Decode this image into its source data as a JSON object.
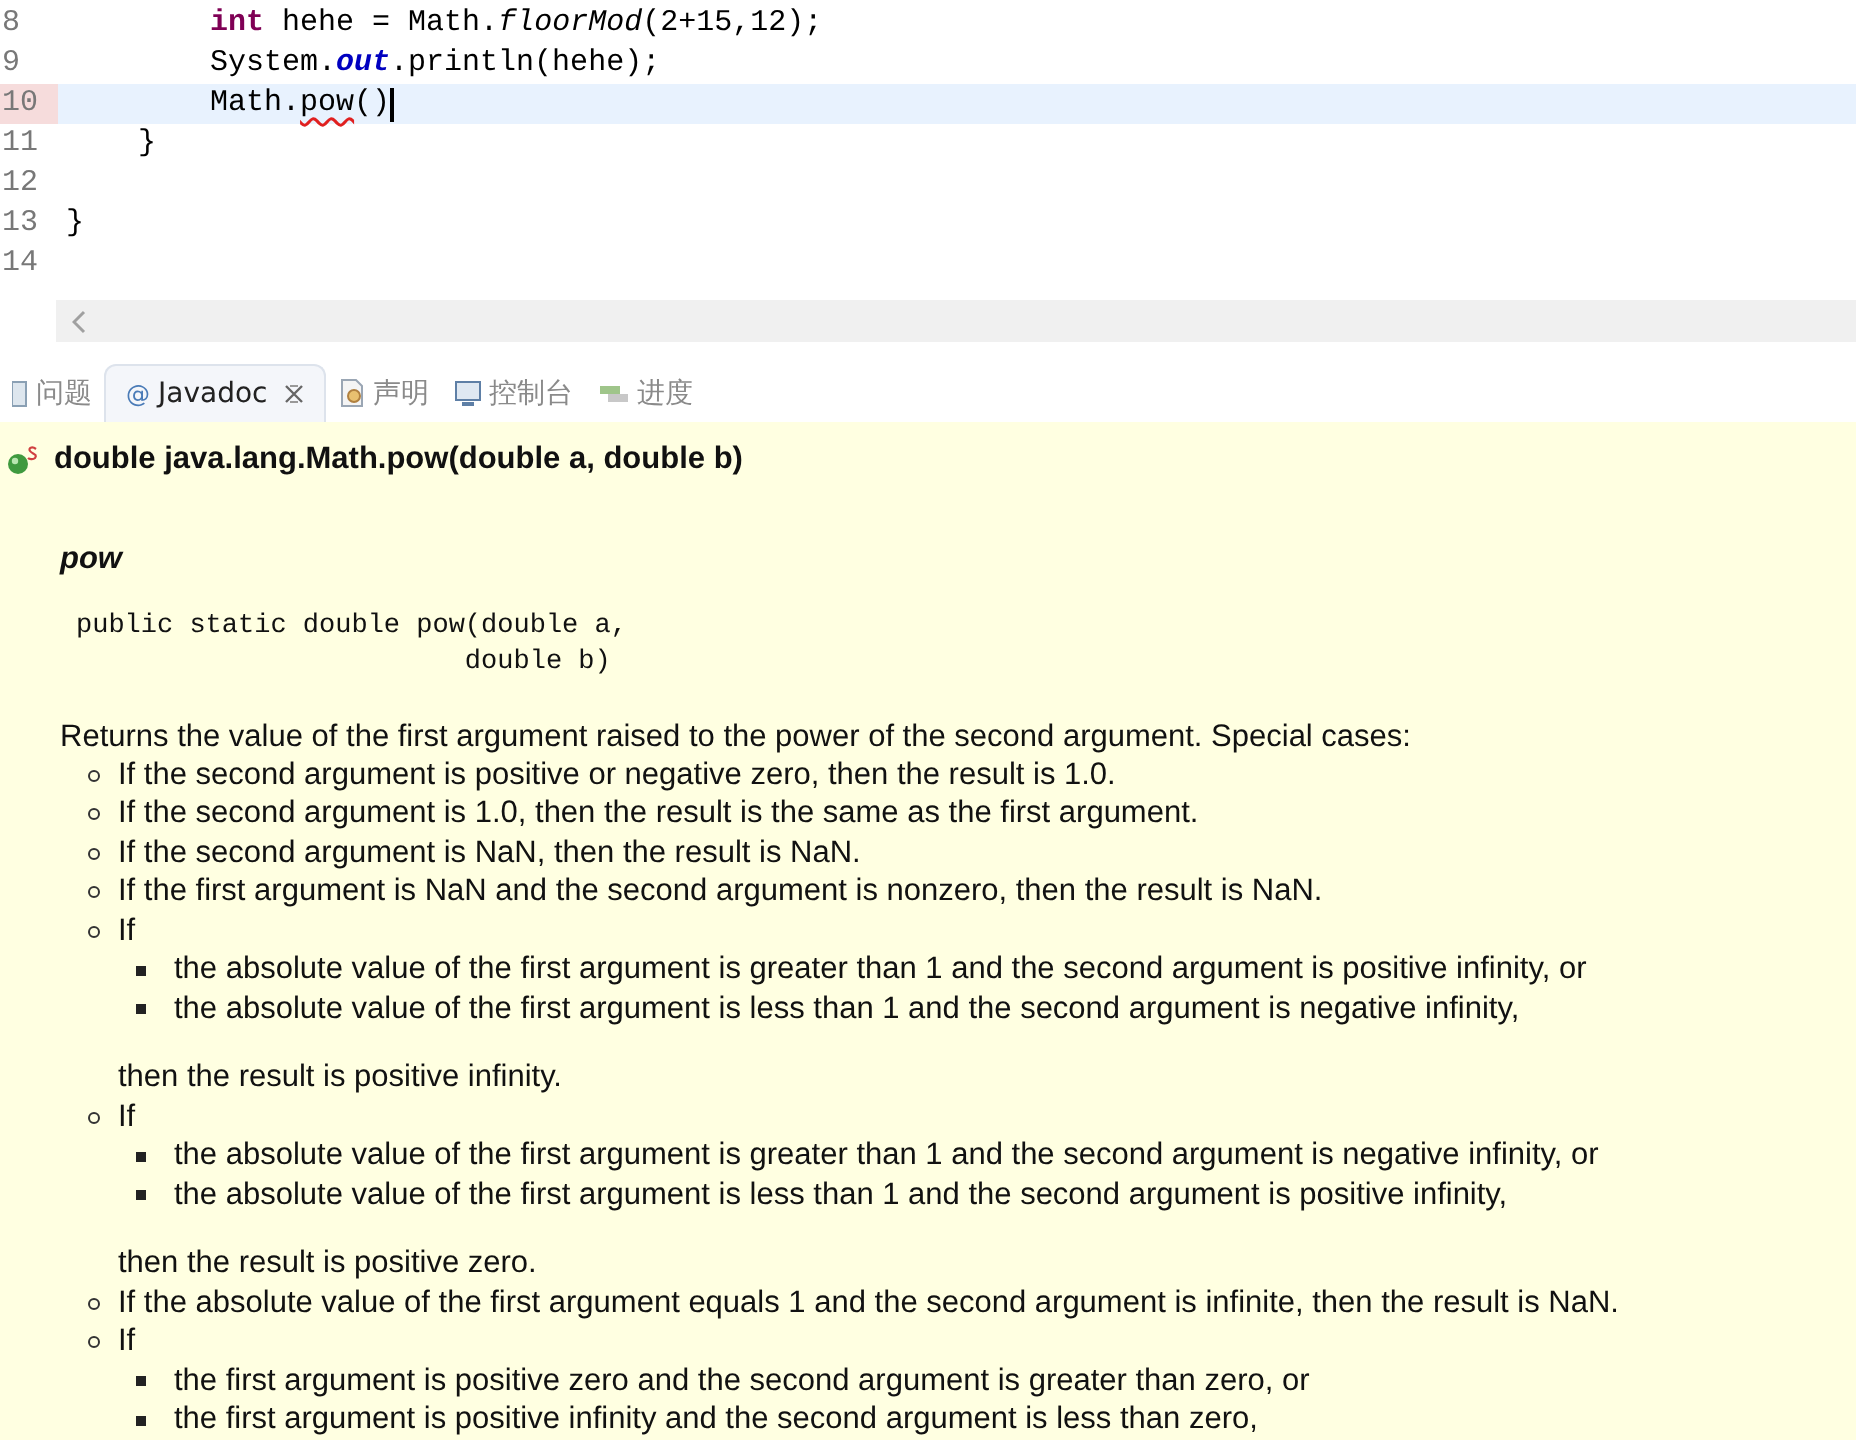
{
  "editor": {
    "lines": [
      {
        "number": "8",
        "current": false,
        "segments": [
          {
            "kind": "keyword",
            "text": "        int"
          },
          {
            "kind": "plain",
            "text": " hehe = Math."
          },
          {
            "kind": "static-method",
            "text": "floorMod"
          },
          {
            "kind": "plain",
            "text": "(2+15,12);"
          }
        ]
      },
      {
        "number": "9",
        "current": false,
        "segments": [
          {
            "kind": "plain",
            "text": "        System."
          },
          {
            "kind": "static-field",
            "text": "out"
          },
          {
            "kind": "plain",
            "text": ".println(hehe);"
          }
        ]
      },
      {
        "number": "10",
        "current": true,
        "segments": [
          {
            "kind": "plain",
            "text": "        Math."
          },
          {
            "kind": "error",
            "text": "pow"
          },
          {
            "kind": "plain",
            "text": "()"
          }
        ]
      },
      {
        "number": "11",
        "current": false,
        "segments": [
          {
            "kind": "plain",
            "text": "    }"
          }
        ]
      },
      {
        "number": "12",
        "current": false
      },
      {
        "number": "13",
        "current": false,
        "segments": [
          {
            "kind": "plain",
            "text": "}"
          }
        ]
      },
      {
        "number": "14",
        "current": false
      }
    ]
  },
  "tabs": [
    {
      "label": "问题",
      "selected": false
    },
    {
      "label": "Javadoc",
      "selected": true,
      "glyph": "@",
      "closable": true
    },
    {
      "label": "声明",
      "selected": false
    },
    {
      "label": "控制台",
      "selected": false
    },
    {
      "label": "进度",
      "selected": false
    }
  ],
  "javadoc": {
    "signature": "double java.lang.Math.pow(double a, double b)",
    "method": "pow",
    "declaration": [
      "public static double pow(double a,",
      "                        double b)"
    ],
    "description": "Returns the value of the first argument raised to the power of the second argument. Special cases:",
    "cases": [
      {
        "kind": "text",
        "text": "If the second argument is positive or negative zero, then the result is 1.0."
      },
      {
        "kind": "text",
        "text": "If the second argument is 1.0, then the result is the same as the first argument."
      },
      {
        "kind": "text",
        "text": "If the second argument is NaN, then the result is NaN."
      },
      {
        "kind": "text",
        "text": "If the first argument is NaN and the second argument is nonzero, then the result is NaN."
      },
      {
        "kind": "nested",
        "text": "If",
        "children": [
          "the absolute value of the first argument is greater than 1 and the second argument is positive infinity, or",
          "the absolute value of the first argument is less than 1 and the second argument is negative infinity,"
        ],
        "outro": "then the result is positive infinity."
      },
      {
        "kind": "nested",
        "text": "If",
        "children": [
          "the absolute value of the first argument is greater than 1 and the second argument is negative infinity, or",
          "the absolute value of the first argument is less than 1 and the second argument is positive infinity,"
        ],
        "outro": "then the result is positive zero."
      },
      {
        "kind": "text",
        "text": "If the absolute value of the first argument equals 1 and the second argument is infinite, then the result is NaN."
      },
      {
        "kind": "nested",
        "text": "If",
        "children": [
          "the first argument is positive zero and the second argument is greater than zero, or",
          "the first argument is positive infinity and the second argument is less than zero,"
        ]
      }
    ]
  }
}
